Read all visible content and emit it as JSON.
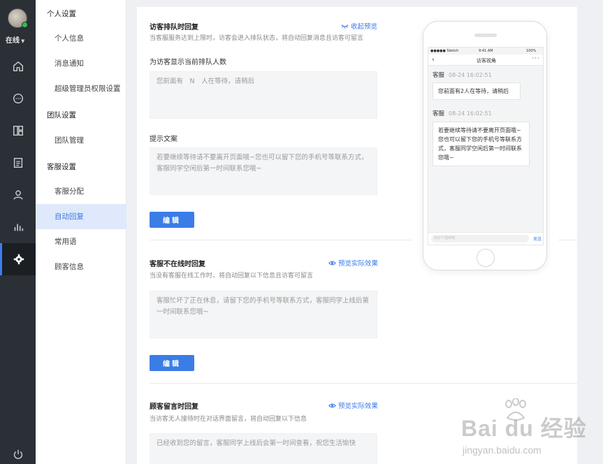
{
  "rail": {
    "status_label": "在线",
    "icons": [
      "home-icon",
      "chat-icon",
      "layout-icon",
      "document-icon",
      "user-icon",
      "chart-icon",
      "gear-icon",
      "power-icon"
    ]
  },
  "subnav": {
    "groups": [
      {
        "label": "个人设置",
        "items": [
          "个人信息",
          "消息通知",
          "超级管理员权限设置"
        ]
      },
      {
        "label": "团队设置",
        "items": [
          "团队管理"
        ]
      },
      {
        "label": "客服设置",
        "items": [
          "客服分配",
          "自动回复",
          "常用语",
          "顾客信息"
        ]
      }
    ],
    "active_item": "自动回复"
  },
  "main": {
    "queue": {
      "title": "访客排队时回复",
      "desc": "当客服服务达到上限时，访客会进入排队状态，将自动回复消息且访客可留言",
      "toggle_link": "收起预览",
      "count_label": "为访客显示当前排队人数",
      "count_text": "您前面有　N　人在等待，请稍后",
      "tip_label": "提示文案",
      "tip_text": "若要继续等待请不要离开页面哦~您也可以留下您的手机号等联系方式，客服同学空闲后第一时间联系您哦~",
      "edit_label": "编辑"
    },
    "offline": {
      "title": "客服不在线时回复",
      "desc": "当没有客服在线工作时，将自动回复以下信息且访客可留言",
      "preview_link": "预览实际效果",
      "text": "客服忙坏了正在休息，请留下您的手机号等联系方式，客服同学上线后第一时间联系您哦~",
      "edit_label": "编辑"
    },
    "message": {
      "title": "顾客留言时回复",
      "desc": "当访客无人接待时在对话界面留言，将自动回复以下信息",
      "preview_link": "预览实际效果",
      "text": "已经收到您的留言，客服同学上线后会第一时间查看，祝您生活愉快"
    }
  },
  "phone": {
    "carrier": "●●●●● Sketch",
    "time": "9:41 AM",
    "battery": "100%",
    "nav_title": "访客视角",
    "messages": [
      {
        "sender": "客服",
        "time": "08-24 16:02:51",
        "text": "您前面有2人在等待，请稍后"
      },
      {
        "sender": "客服",
        "time": "08-24 16:02:51",
        "text": "若要继续等待请不要离开页面哦~您也可以留下您的手机号等联系方式，客服同学空闲后第一时间联系您哦~"
      }
    ],
    "input_placeholder": "先打个招呼吧",
    "send_label": "发送"
  },
  "watermark": {
    "logo_text": "Bai du 经验",
    "url": "jingyan.baidu.com"
  },
  "colors": {
    "accent": "#3b7de6",
    "rail_bg": "#2b2f36",
    "active_nav_bg": "#dfe9fb",
    "online_dot": "#2fbf4f"
  }
}
